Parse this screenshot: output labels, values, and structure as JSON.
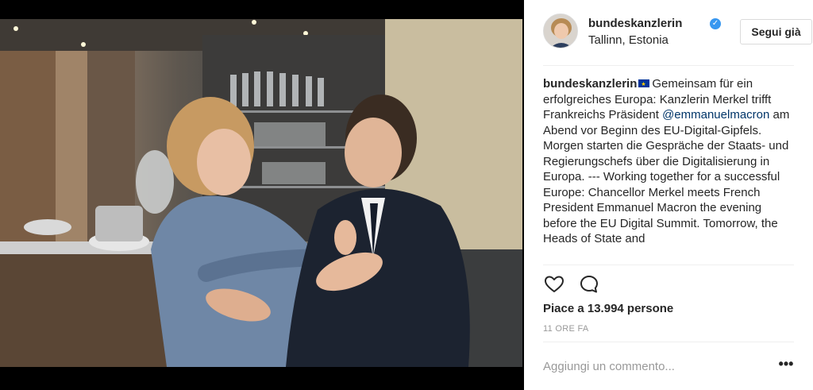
{
  "post": {
    "username": "bundeskanzlerin",
    "location": "Tallinn, Estonia",
    "follow_label": "Segui già",
    "caption": {
      "user": "bundeskanzlerin",
      "text_before_mention": "Gemeinsam für ein erfolgreiches Europa: Kanzlerin Merkel trifft Frankreichs Präsident ",
      "mention": "@emmanuelmacron",
      "text_after_mention": " am Abend vor Beginn des EU-Digital-Gipfels. Morgen starten die Gespräche der Staats- und Regierungschefs über die Digitalisierung in Europa. --- Working together for a successful Europe: Chancellor Merkel meets French President Emmanuel Macron the evening before the EU Digital Summit. Tomorrow, the Heads of State and"
    },
    "likes_text": "Piace a 13.994 persone",
    "timestamp": "11 ORE FA",
    "comment_placeholder": "Aggiungi un commento...",
    "more_label": "•••"
  },
  "icons": {
    "verified": "verified-badge-icon",
    "flag": "eu-flag-icon",
    "like": "heart-icon",
    "comment": "comment-bubble-icon",
    "more": "more-options-icon"
  },
  "colors": {
    "verified_blue": "#3897f0",
    "mention_blue": "#003569",
    "muted_gray": "#999999",
    "border_gray": "#dbdbdb"
  }
}
